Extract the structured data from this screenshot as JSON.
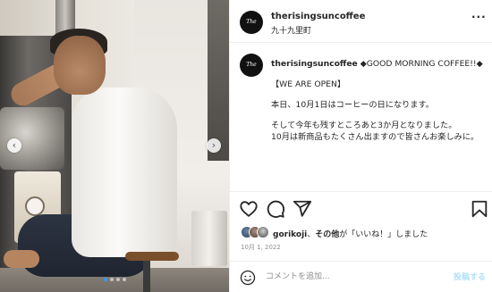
{
  "post": {
    "image": {
      "description_icon": "photo-roaster-man",
      "carousel": {
        "total": 4,
        "active": 1
      }
    },
    "header": {
      "avatar_text": "The Rising Sun Coffee",
      "username": "therisingsuncoffee",
      "location": "九十九里町"
    },
    "caption": {
      "username": "therisingsuncoffee",
      "first_line": "◆GOOD MORNING COFFEE!!◆",
      "lines": [
        "【WE ARE OPEN】",
        "本日、10月1日はコーヒーの日になります。",
        "そして今年も残すところあと3か月となりました。",
        "10月は新商品もたくさん出ますので皆さんお楽しみに。"
      ]
    },
    "likes": {
      "user": "gorikoji",
      "connector": "、",
      "others": "その他",
      "suffix": "が「いいね！」しました"
    },
    "date": "10月 1, 2022",
    "comment": {
      "placeholder": "コメントを追加...",
      "post_label": "投稿する"
    },
    "colors": {
      "accent": "#3897f0",
      "post_disabled": "#b2dffc",
      "text": "#262626",
      "muted": "#8e8e8e"
    }
  }
}
